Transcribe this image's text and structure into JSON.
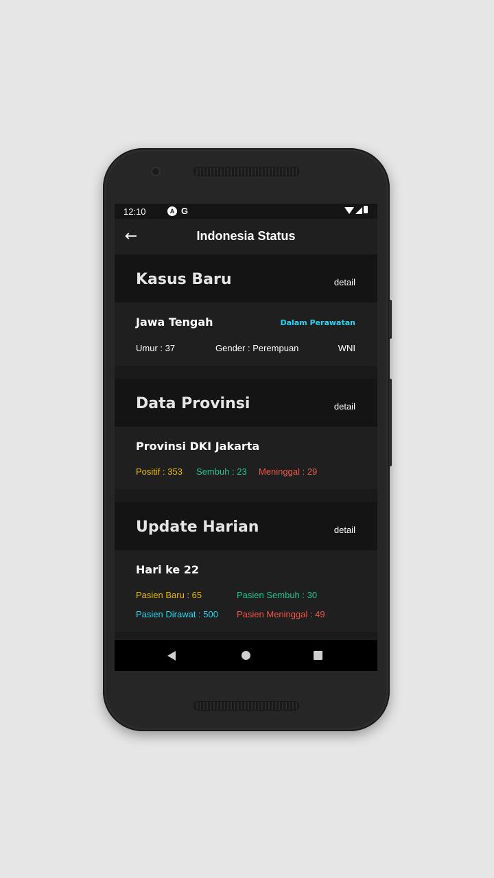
{
  "status_bar": {
    "time": "12:10",
    "icon_a_label": "A",
    "icon_g_label": "G"
  },
  "app_bar": {
    "back_icon": "←",
    "title": "Indonesia Status"
  },
  "kasus_baru": {
    "title": "Kasus Baru",
    "detail": "detail",
    "card": {
      "region": "Jawa Tengah",
      "status": "Dalam Perawatan",
      "age": "Umur : 37",
      "gender": "Gender : Perempuan",
      "citizenship": "WNI"
    }
  },
  "data_provinsi": {
    "title": "Data Provinsi",
    "detail": "detail",
    "card": {
      "province": "Provinsi DKI Jakarta",
      "positive": "Positif : 353",
      "recovered": "Sembuh : 23",
      "deaths": "Meninggal : 29"
    }
  },
  "update_harian": {
    "title": "Update Harian",
    "detail": "detail",
    "card": {
      "day": "Hari ke 22",
      "new_patients": "Pasien Baru : 65",
      "recovered": "Pasien Sembuh : 30",
      "treated": "Pasien Dirawat : 500",
      "deaths": "Pasien Meninggal : 49"
    }
  },
  "colors": {
    "positive": "#e8b800",
    "recovered": "#20c48c",
    "deaths": "#f0564a",
    "treated": "#2ad4f0"
  }
}
